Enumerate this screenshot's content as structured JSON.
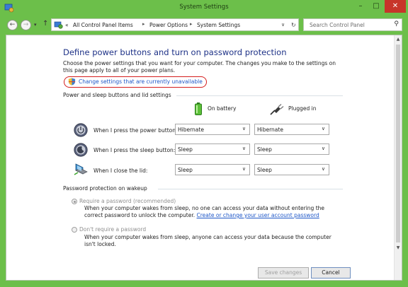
{
  "window": {
    "title": "System Settings"
  },
  "address_bar": {
    "crumbs": [
      "«",
      "All Control Panel Items",
      "Power Options",
      "System Settings"
    ],
    "search_placeholder": "Search Control Panel"
  },
  "page": {
    "title": "Define power buttons and turn on password protection",
    "intro": "Choose the power settings that you want for your computer. The changes you make to the settings on this page apply to all of your power plans.",
    "change_link": "Change settings that are currently unavailable"
  },
  "power_section": {
    "heading": "Power and sleep buttons and lid settings",
    "columns": [
      "On battery",
      "Plugged in"
    ],
    "rows": [
      {
        "label": "When I press the power button:",
        "battery": "Hibernate",
        "plugged": "Hibernate",
        "icon": "power-button-icon"
      },
      {
        "label": "When I press the sleep button:",
        "battery": "Sleep",
        "plugged": "Sleep",
        "icon": "sleep-button-icon"
      },
      {
        "label": "When I close the lid:",
        "battery": "Sleep",
        "plugged": "Sleep",
        "icon": "laptop-lid-icon"
      }
    ]
  },
  "password_section": {
    "heading": "Password protection on wakeup",
    "options": [
      {
        "label": "Require a password (recommended)",
        "selected": true,
        "desc_before": "When your computer wakes from sleep, no one can access your data without entering the correct password to unlock the computer. ",
        "link": "Create or change your user account password"
      },
      {
        "label": "Don't require a password",
        "selected": false,
        "desc_before": "When your computer wakes from sleep, anyone can access your data because the computer isn't locked.",
        "link": ""
      }
    ]
  },
  "footer": {
    "save": "Save changes",
    "cancel": "Cancel"
  },
  "colors": {
    "frame": "#6cbf4a",
    "close": "#c7352a",
    "link": "#1e57c8",
    "title": "#1e3287",
    "highlight": "#d41d1d"
  }
}
